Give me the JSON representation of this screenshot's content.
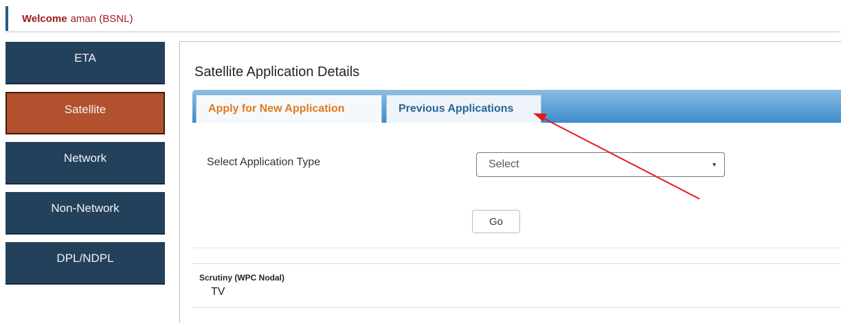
{
  "header": {
    "welcome_label": "Welcome",
    "user_text": "aman (BSNL)"
  },
  "sidebar": {
    "items": [
      {
        "label": "ETA"
      },
      {
        "label": "Satellite",
        "active": true
      },
      {
        "label": "Network"
      },
      {
        "label": "Non-Network"
      },
      {
        "label": "DPL/NDPL"
      }
    ]
  },
  "main": {
    "title": "Satellite Application Details",
    "tabs": [
      {
        "label": "Apply for New Application",
        "active": true
      },
      {
        "label": "Previous Applications",
        "active": false
      }
    ],
    "form": {
      "app_type_label": "Select Application Type",
      "app_type_selected": "Select",
      "go_label": "Go"
    },
    "scrutiny": {
      "title": "Scrutiny (WPC Nodal)",
      "value": "TV"
    }
  },
  "colors": {
    "sidebar_bg": "#24415c",
    "sidebar_active": "#b2512e",
    "welcome_text": "#a3171e",
    "active_tab_text": "#e2791e",
    "tab_text": "#2a6496",
    "annotation_arrow": "#e8161b"
  },
  "icons": {
    "select_caret": "chevron-down-icon",
    "annotation": "red-arrow"
  }
}
